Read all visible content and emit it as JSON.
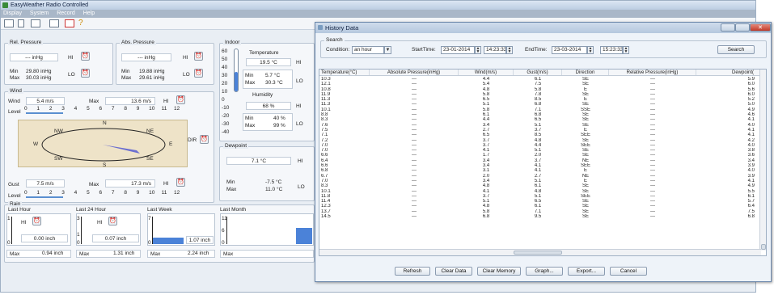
{
  "main": {
    "title": "EasyWeather Radio Controlled",
    "menu": [
      "Display",
      "System",
      "Record",
      "Help"
    ],
    "rel_pressure": {
      "legend": "Rel. Pressure",
      "value": "--- inHg",
      "hi": "HI",
      "lo": "LO",
      "min_label": "Min",
      "min": "29.80 inHg",
      "max_label": "Max",
      "max": "30.03 inHg"
    },
    "abs_pressure": {
      "legend": "Abs. Pressure",
      "value": "--- inHg",
      "hi": "HI",
      "lo": "LO",
      "min_label": "Min",
      "min": "19.88 inHg",
      "max_label": "Max",
      "max": "29.61 inHg"
    },
    "wind": {
      "legend": "Wind",
      "wind_label": "Wind",
      "wind_value": "5.4 m/s",
      "max_label": "Max",
      "max_value": "13.6 m/s",
      "hi": "HI",
      "level_label": "Level",
      "scale": [
        "0",
        "1",
        "2",
        "3",
        "4",
        "5",
        "6",
        "7",
        "8",
        "9",
        "10",
        "11",
        "12"
      ]
    },
    "compass": {
      "n": "N",
      "s": "S",
      "e": "E",
      "w": "W",
      "ne": "NE",
      "nw": "NW",
      "se": "SE",
      "sw": "SW",
      "dir": "DIR"
    },
    "gust": {
      "gust_label": "Gust",
      "gust_value": "7.5 m/s",
      "max_label": "Max",
      "max_value": "17.3 m/s",
      "hi": "HI",
      "level_label": "Level",
      "scale": [
        "0",
        "1",
        "2",
        "3",
        "4",
        "5",
        "6",
        "7",
        "8",
        "9",
        "10",
        "11",
        "12"
      ]
    },
    "indoor": {
      "legend": "Indoor",
      "temp_label": "Temperature",
      "temp": "19.5 °C",
      "hi": "HI",
      "lo": "LO",
      "min_label": "Min",
      "min": "5.7 °C",
      "max_label": "Max",
      "max": "30.3 °C",
      "humidity_label": "Humidity",
      "humidity": "68 %",
      "hmin_label": "Min",
      "hmin": "40 %",
      "hmax_label": "Max",
      "hmax": "99 %",
      "scale": [
        "60",
        "50",
        "40",
        "30",
        "20",
        "10",
        "0",
        "-10",
        "-20",
        "-30",
        "-40"
      ]
    },
    "dewpoint": {
      "legend": "Dewpoint",
      "value": "7.1 °C",
      "hi": "HI",
      "lo": "LO",
      "min_label": "Min",
      "min": "-7.5 °C",
      "max_label": "Max",
      "max": "11.0 °C"
    },
    "rain": {
      "legend": "Rain",
      "last_hour": "Last Hour",
      "last24": "Last 24 Hour",
      "last_week": "Last Week",
      "last_month": "Last Month",
      "v1": "0.00 inch",
      "v2": "0.07 inch",
      "v3": "1.07 inch",
      "hi": "HI",
      "max_label": "Max",
      "max1": "0.94 inch",
      "max2": "1.31 inch",
      "max3": "2.24 inch",
      "ax1": [
        "1",
        "0"
      ],
      "ax2": [
        "3",
        "1",
        "0"
      ],
      "ax3": [
        "7",
        "0"
      ],
      "ax4": [
        "11",
        "6",
        "0"
      ],
      "level3": 0.25
    }
  },
  "dialog": {
    "title": "History Data",
    "search_legend": "Search",
    "condition_label": "Condition:",
    "condition": "an hour",
    "start_label": "StartTime:",
    "start_date": "23-01-2014",
    "start_time": "14:23:33",
    "end_label": "EndTime:",
    "end_date": "23-03-2014",
    "end_time": "15:23:33",
    "search_btn": "Search",
    "columns": [
      "Temperature(°C)",
      "Absolute Pressure(inHg)",
      "Wind(m/s)",
      "Gust(m/s)",
      "Direction",
      "Relative Pressure(inHg)",
      "Dewpoint("
    ],
    "rows": [
      [
        "10.3",
        "---",
        "4.4",
        "6.1",
        "SE",
        "---",
        "5.9"
      ],
      [
        "12.1",
        "---",
        "5.4",
        "7.5",
        "SE",
        "---",
        "6.0"
      ],
      [
        "10.8",
        "---",
        "4.8",
        "5.8",
        "E",
        "---",
        "5.6"
      ],
      [
        "11.9",
        "---",
        "5.8",
        "7.8",
        "SE",
        "---",
        "6.0"
      ],
      [
        "11.3",
        "---",
        "6.5",
        "8.5",
        "E",
        "---",
        "5.2"
      ],
      [
        "11.3",
        "---",
        "5.1",
        "6.8",
        "SE",
        "---",
        "5.0"
      ],
      [
        "10.1",
        "---",
        "5.8",
        "7.1",
        "SSE",
        "---",
        "4.9"
      ],
      [
        "8.8",
        "---",
        "6.1",
        "6.8",
        "SE",
        "---",
        "4.6"
      ],
      [
        "8.3",
        "---",
        "4.4",
        "6.5",
        "SE",
        "---",
        "4.1"
      ],
      [
        "7.6",
        "---",
        "3.4",
        "5.1",
        "SE",
        "---",
        "4.0"
      ],
      [
        "7.5",
        "---",
        "2.7",
        "3.7",
        "E",
        "---",
        "4.1"
      ],
      [
        "7.1",
        "---",
        "6.5",
        "8.5",
        "SEE",
        "---",
        "4.1"
      ],
      [
        "7.2",
        "---",
        "3.7",
        "4.8",
        "SE",
        "---",
        "4.2"
      ],
      [
        "7.0",
        "---",
        "3.7",
        "4.4",
        "SEE",
        "---",
        "4.0"
      ],
      [
        "7.0",
        "---",
        "4.1",
        "5.1",
        "SE",
        "---",
        "3.8"
      ],
      [
        "6.6",
        "---",
        "1.7",
        "2.0",
        "SE",
        "---",
        "3.6"
      ],
      [
        "6.4",
        "---",
        "3.4",
        "3.7",
        "NE",
        "---",
        "3.4"
      ],
      [
        "6.6",
        "---",
        "3.4",
        "4.1",
        "SEE",
        "---",
        "3.9"
      ],
      [
        "6.8",
        "---",
        "3.1",
        "4.1",
        "E",
        "---",
        "4.0"
      ],
      [
        "6.7",
        "---",
        "2.0",
        "2.7",
        "NE",
        "---",
        "3.9"
      ],
      [
        "7.0",
        "---",
        "3.4",
        "5.1",
        "E",
        "---",
        "4.1"
      ],
      [
        "8.3",
        "---",
        "4.8",
        "6.1",
        "SE",
        "---",
        "4.9"
      ],
      [
        "10.1",
        "---",
        "4.1",
        "4.8",
        "SE",
        "---",
        "5.5"
      ],
      [
        "11.8",
        "---",
        "3.7",
        "5.1",
        "SEE",
        "---",
        "6.1"
      ],
      [
        "11.4",
        "---",
        "5.1",
        "6.5",
        "SE",
        "---",
        "5.7"
      ],
      [
        "12.3",
        "---",
        "4.8",
        "6.1",
        "SE",
        "---",
        "6.4"
      ],
      [
        "13.7",
        "---",
        "5.8",
        "7.1",
        "SE",
        "---",
        "7.5"
      ],
      [
        "14.5",
        "---",
        "6.8",
        "9.5",
        "SE",
        "---",
        "6.8"
      ]
    ],
    "buttons": [
      "Refresh",
      "Clear Data",
      "Clear Memory",
      "Graph...",
      "Export...",
      "Cancel"
    ]
  }
}
